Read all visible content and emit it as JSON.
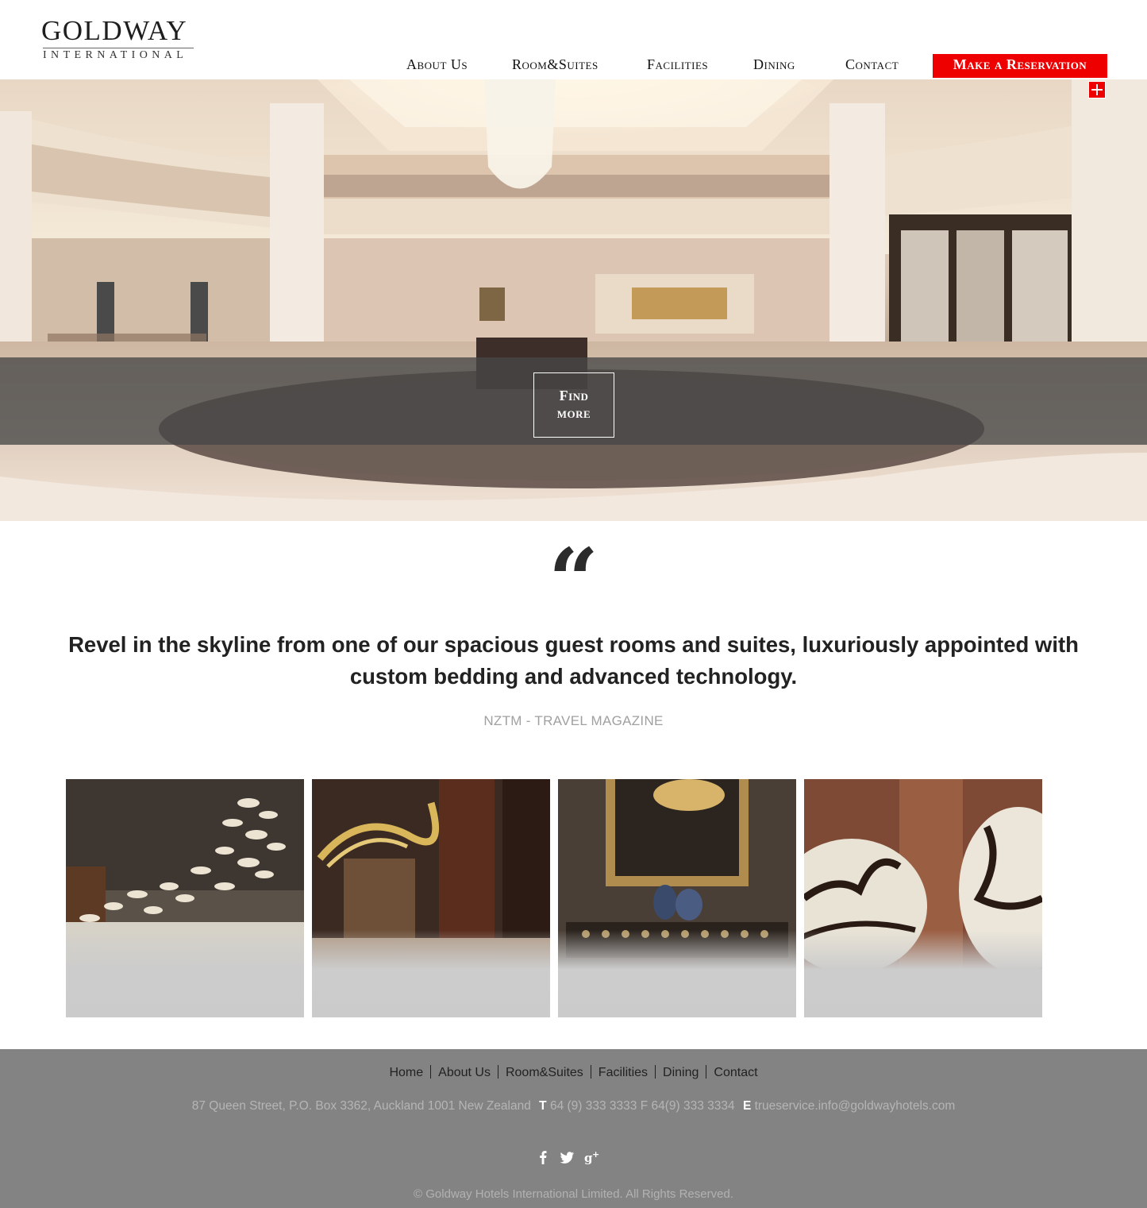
{
  "brand": {
    "name": "GOLDWAY",
    "subtitle": "INTERNATIONAL"
  },
  "nav": {
    "items": [
      {
        "label": "About Us"
      },
      {
        "label": "Room&Suites"
      },
      {
        "label": "Facilities"
      },
      {
        "label": "Dining"
      },
      {
        "label": "Contact"
      }
    ],
    "reserve_label": "Make a Reservation"
  },
  "hero": {
    "cta_line1": "Find",
    "cta_line2": "more"
  },
  "quote": {
    "mark": "“",
    "text": "Revel in the skyline from one of our spacious guest rooms and suites, luxuriously appointed with custom bedding and advanced technology.",
    "source": "NZTM - TRAVEL MAGAZINE"
  },
  "gallery": [
    {
      "icon": "lobby-chandelier-photo"
    },
    {
      "icon": "golden-sculpture-photo"
    },
    {
      "icon": "mirror-vases-photo"
    },
    {
      "icon": "egg-sculptures-photo"
    }
  ],
  "footer": {
    "nav": [
      "Home",
      "About Us",
      "Room&Suites",
      "Facilities",
      "Dining",
      "Contact"
    ],
    "address": "87 Queen Street, P.O. Box 3362, Auckland 1001 New Zealand",
    "phone_label": "T",
    "phone": "64 (9) 333 3333 F 64(9) 333 3334",
    "email_label": "E",
    "email": "trueservice.info@goldwayhotels.com",
    "copyright": "© Goldway Hotels International Limited. All Rights Reserved."
  },
  "colors": {
    "accent": "#ee0000",
    "footer_bg": "#838383"
  }
}
